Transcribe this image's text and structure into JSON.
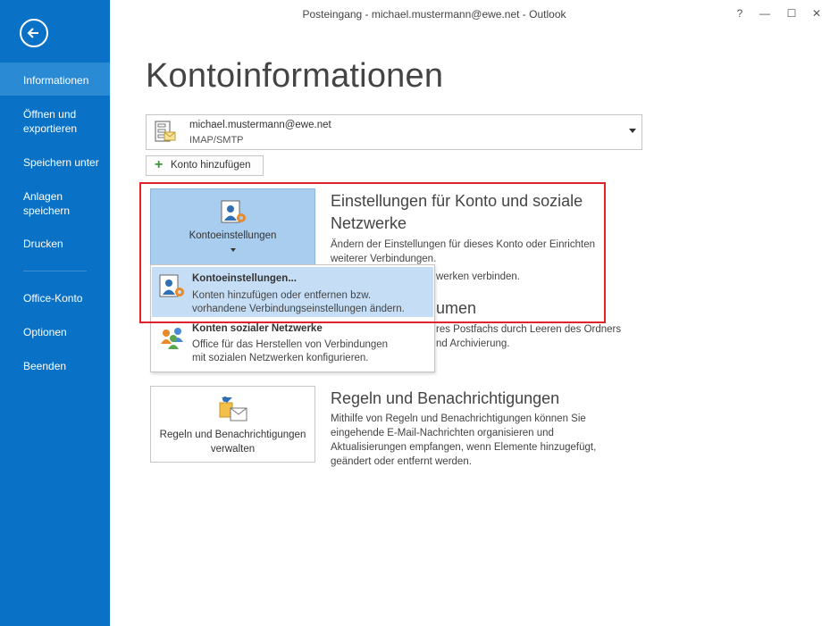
{
  "window": {
    "title": "Posteingang - michael.mustermann@ewe.net - Outlook",
    "help": "?",
    "minimize": "—",
    "maximize": "☐",
    "close": "✕"
  },
  "sidebar": {
    "items": [
      {
        "label": "Informationen"
      },
      {
        "label": "Öffnen und exportieren"
      },
      {
        "label": "Speichern unter"
      },
      {
        "label": "Anlagen speichern"
      },
      {
        "label": "Drucken"
      },
      {
        "label": "Office-Konto"
      },
      {
        "label": "Optionen"
      },
      {
        "label": "Beenden"
      }
    ]
  },
  "page": {
    "title": "Kontoinformationen"
  },
  "account": {
    "email": "michael.mustermann@ewe.net",
    "type": "IMAP/SMTP",
    "add_label": "Konto hinzufügen"
  },
  "sections": {
    "settings": {
      "button_label": "Kontoeinstellungen",
      "heading": "Einstellungen für Konto und soziale Netzwerke",
      "desc_line1": "Ändern der Einstellungen für dieses Konto oder Einrichten",
      "desc_line2": "weiterer Verbindungen.",
      "desc_line3": "werken verbinden."
    },
    "cleanup": {
      "heading_fragment": "umen",
      "desc_line1": "res Postfachs durch Leeren des Ordners",
      "desc_line2": "nd Archivierung."
    },
    "rules": {
      "button_label": "Regeln und Benachrichtigungen verwalten",
      "heading": "Regeln und Benachrichtigungen",
      "desc_line1": "Mithilfe von Regeln und Benachrichtigungen können Sie",
      "desc_line2": "eingehende E-Mail-Nachrichten organisieren und",
      "desc_line3": "Aktualisierungen empfangen, wenn Elemente hinzugefügt,",
      "desc_line4": "geändert oder entfernt werden."
    }
  },
  "dropdown": {
    "items": [
      {
        "title": "Kontoeinstellungen...",
        "desc1": "Konten hinzufügen oder entfernen bzw.",
        "desc2": "vorhandene Verbindungseinstellungen ändern."
      },
      {
        "title": "Konten sozialer Netzwerke",
        "desc1": "Office für das Herstellen von Verbindungen",
        "desc2": "mit sozialen Netzwerken konfigurieren."
      }
    ]
  },
  "colors": {
    "sidebar": "#0a72c6",
    "sidebar_active": "#2a8ad4",
    "highlight_frame": "#e0222b",
    "pressed_button": "#a8cdee",
    "menu_highlight": "#c5def5"
  }
}
